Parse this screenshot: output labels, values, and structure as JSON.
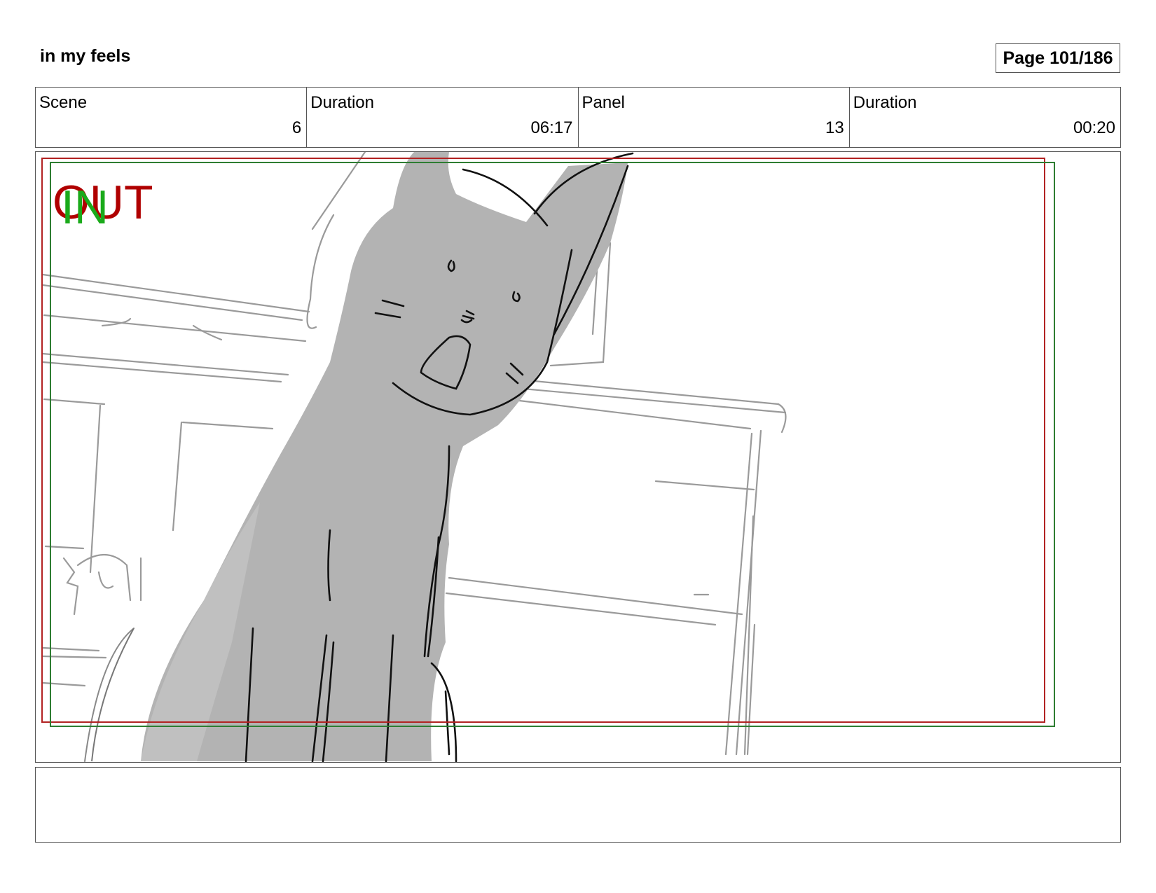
{
  "header": {
    "title": "in my feels",
    "page_label": "Page 101/186"
  },
  "info": {
    "scene_label": "Scene",
    "scene_value": "6",
    "scene_duration_label": "Duration",
    "scene_duration_value": "06:17",
    "panel_label": "Panel",
    "panel_value": "13",
    "panel_duration_label": "Duration",
    "panel_duration_value": "00:20"
  },
  "panel": {
    "out_marker": "OUT",
    "in_marker": "IN",
    "out_color": "#b00000",
    "in_color": "#1aaa1a",
    "safe_frame_red": "#b22222",
    "safe_frame_green": "#2e7d32"
  },
  "notes": {
    "text": ""
  }
}
